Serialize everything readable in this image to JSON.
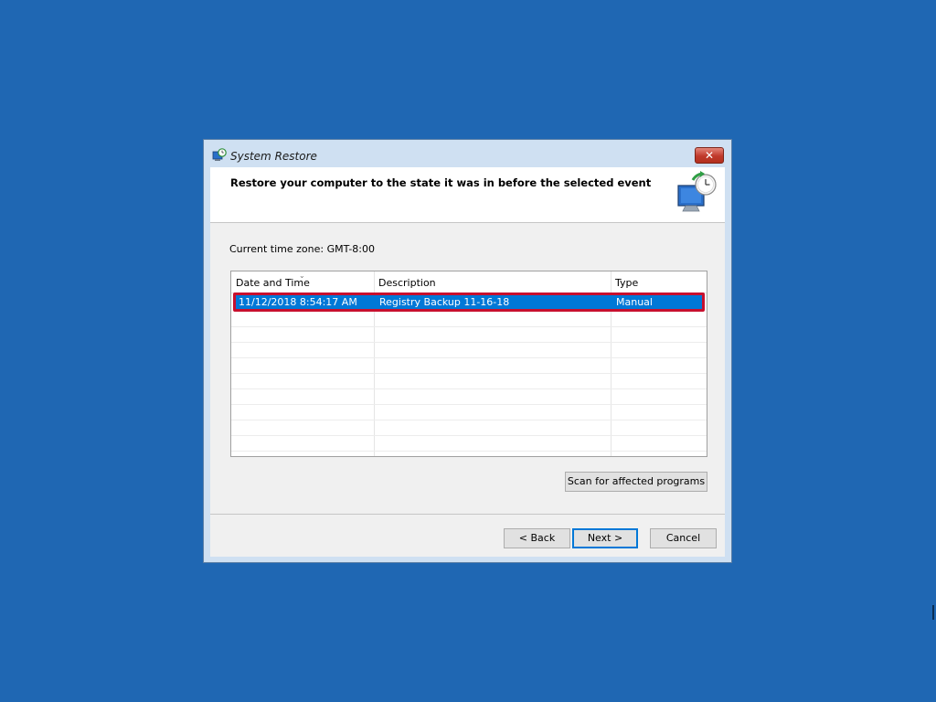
{
  "window": {
    "title": "System Restore",
    "close_glyph": "✕"
  },
  "header": {
    "instruction": "Restore your computer to the state it was in before the selected event",
    "icon": "system-restore-monitor-icon"
  },
  "timezone_label": "Current time zone: GMT-8:00",
  "list": {
    "columns": [
      "Date and Time",
      "Description",
      "Type"
    ],
    "sort_indicator": "⌄",
    "rows": [
      {
        "date_time": "11/12/2018 8:54:17 AM",
        "description": "Registry Backup 11-16-18",
        "type": "Manual",
        "selected": true
      }
    ]
  },
  "buttons": {
    "scan": "Scan for affected programs",
    "back": "< Back",
    "next": "Next >",
    "cancel": "Cancel"
  },
  "colors": {
    "desktop": "#1f67b3",
    "selection": "#0078d7",
    "highlight_border": "#c8102e",
    "close_button": "#c0392b"
  }
}
